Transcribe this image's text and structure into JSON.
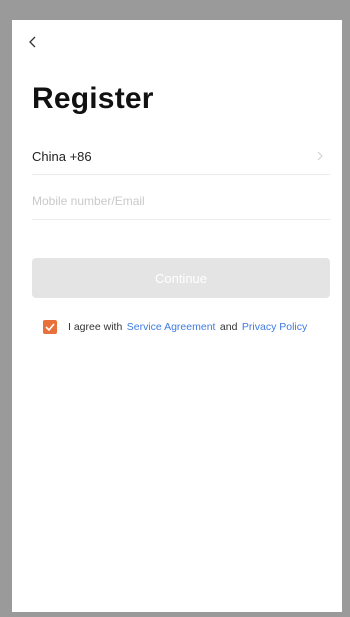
{
  "colors": {
    "frame": "#9a9a9a",
    "accent": "#e8703a",
    "link": "#3f7be0",
    "button_disabled": "#e4e4e4"
  },
  "header": {
    "back_icon": "chevron-left-icon",
    "title": "Register"
  },
  "form": {
    "country_label": "China +86",
    "country_icon": "chevron-right-icon",
    "account_placeholder": "Mobile number/Email",
    "account_value": "",
    "continue_label": "Continue",
    "continue_disabled": true
  },
  "agreement": {
    "checked": true,
    "prefix": "I agree with",
    "service_link": "Service Agreement",
    "conjunction": "and",
    "privacy_link": "Privacy Policy"
  }
}
